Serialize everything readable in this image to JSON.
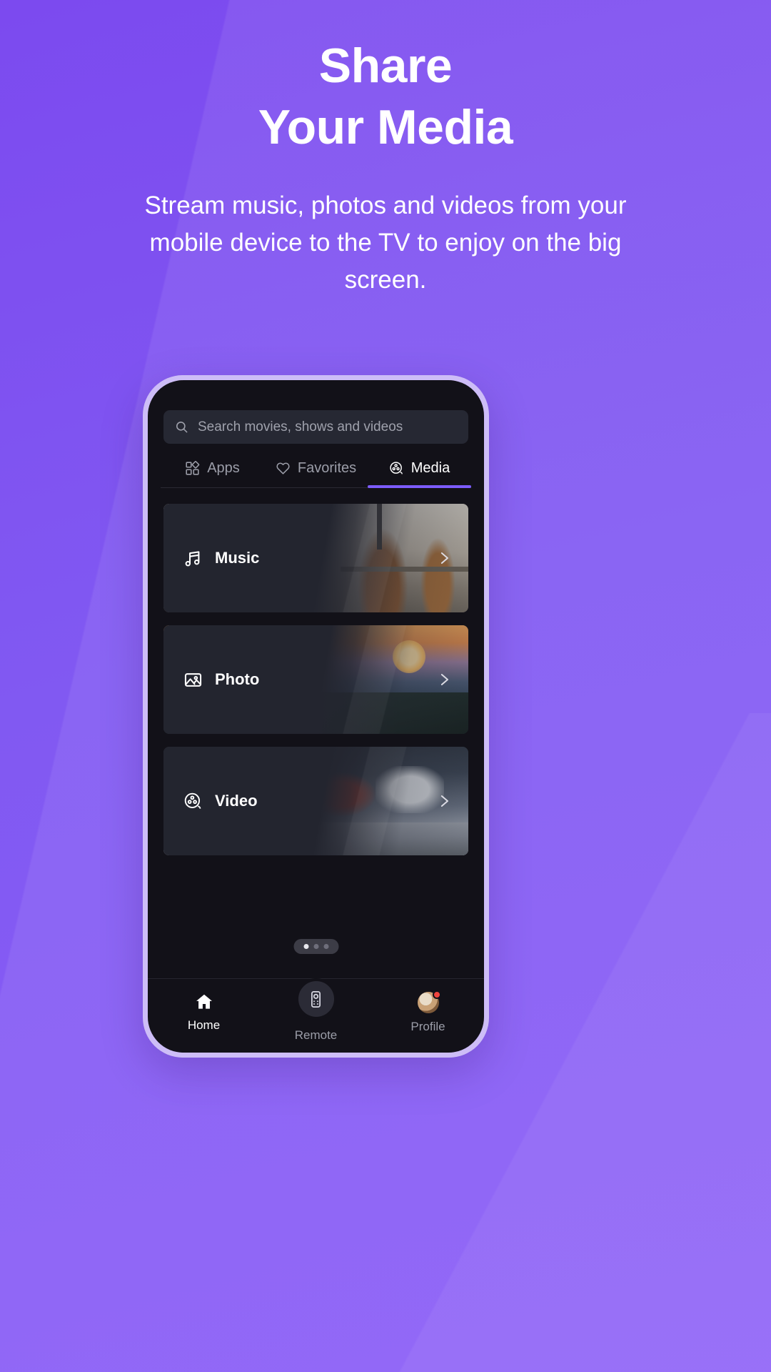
{
  "promo": {
    "headline_line1": "Share",
    "headline_line2": "Your Media",
    "subtitle": "Stream music, photos and videos from your mobile device to the TV to enjoy on the big screen.",
    "bg_color_from": "#7C4AEF",
    "bg_color_to": "#8A5CF7",
    "text_color": "#FFFFFF"
  },
  "phone": {
    "frame_color": "#CDBDF7",
    "screen_bg": "#121118"
  },
  "search": {
    "icon": "search-icon",
    "placeholder": "Search movies, shows and videos",
    "value": "",
    "field_bg": "#262833",
    "placeholder_color": "#9FA1AC"
  },
  "tabs": {
    "active_index": 2,
    "active_underline_color": "#7C5CFC",
    "items": [
      {
        "label": "Apps",
        "icon": "grid-apps-icon",
        "active": false
      },
      {
        "label": "Favorites",
        "icon": "heart-icon",
        "active": false
      },
      {
        "label": "Media",
        "icon": "film-reel-icon",
        "active": true
      }
    ]
  },
  "media_cards": [
    {
      "label": "Music",
      "icon": "music-note-icon",
      "chevron": "chevron-right-icon"
    },
    {
      "label": "Photo",
      "icon": "image-picture-icon",
      "chevron": "chevron-right-icon"
    },
    {
      "label": "Video",
      "icon": "film-reel-icon",
      "chevron": "chevron-right-icon"
    }
  ],
  "page_indicator": {
    "total": 3,
    "current": 1,
    "pill_bg": "#3C3C46",
    "active_dot_color": "#E8E8EE",
    "inactive_dot_color": "#6E6E7B"
  },
  "bottom_nav": {
    "active_index": 0,
    "items": [
      {
        "label": "Home",
        "icon": "home-icon",
        "active": true
      },
      {
        "label": "Remote",
        "icon": "remote-control-icon",
        "active": false
      },
      {
        "label": "Profile",
        "icon": "avatar-icon",
        "active": false,
        "badge": true
      }
    ]
  }
}
